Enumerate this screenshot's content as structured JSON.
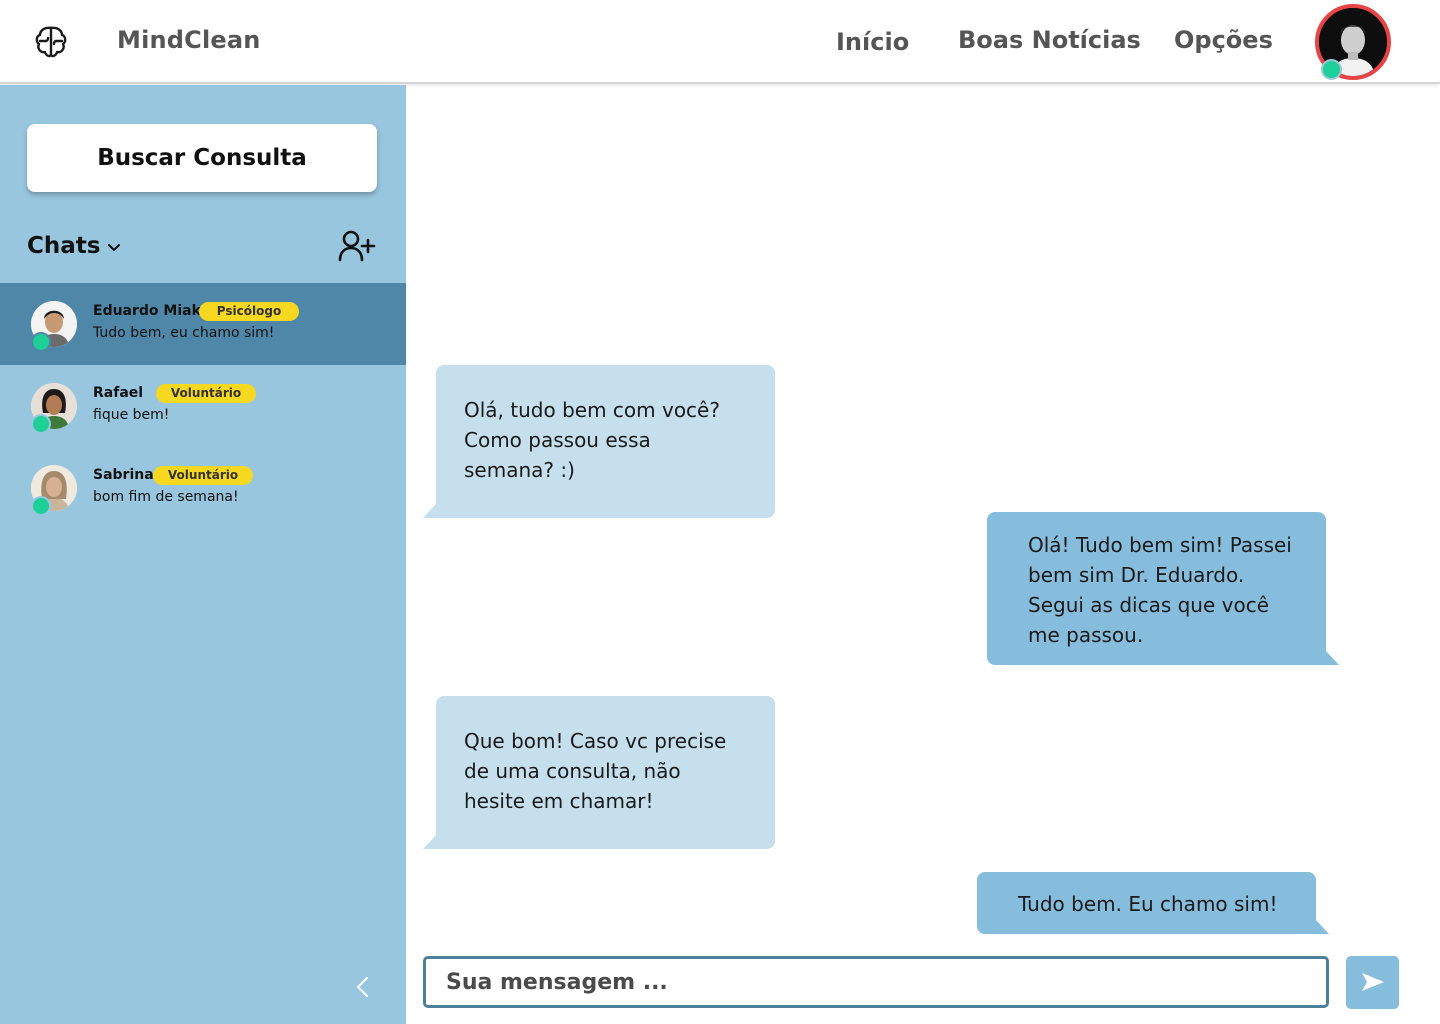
{
  "app": {
    "brand": "MindClean"
  },
  "nav": {
    "items": [
      "Início",
      "Boas Notícias",
      "Opções"
    ]
  },
  "sidebar": {
    "search_button": "Buscar Consulta",
    "chats_label": "Chats",
    "chats": [
      {
        "name": "Eduardo Miaki",
        "role": "Psicólogo",
        "preview": "Tudo bem, eu chamo sim!",
        "active": true
      },
      {
        "name": "Rafael",
        "role": "Voluntário",
        "preview": "fique bem!",
        "active": false
      },
      {
        "name": "Sabrina",
        "role": "Voluntário",
        "preview": "bom fim de semana!",
        "active": false
      }
    ]
  },
  "messages": [
    {
      "direction": "in",
      "text": "Olá, tudo bem com você?\nComo passou essa\nsemana? :)"
    },
    {
      "direction": "out",
      "text": "Olá! Tudo bem sim! Passei\nbem sim Dr. Eduardo.\nSegui as dicas que você\nme passou."
    },
    {
      "direction": "in",
      "text": "Que bom! Caso vc precise\nde uma consulta, não\nhesite em chamar!"
    },
    {
      "direction": "out",
      "text": "Tudo bem. Eu chamo sim!"
    }
  ],
  "composer": {
    "placeholder": "Sua mensagem ..."
  },
  "icons": {
    "logo": "brain-icon",
    "chats_toggle": "chevron-down-icon",
    "add_user": "add-user-icon",
    "collapse": "chevron-left-icon",
    "send": "send-icon"
  },
  "colors": {
    "sidebar": "#98c6df",
    "active_chat": "#4f87a8",
    "incoming_bubble": "#c5dfed",
    "outgoing_bubble": "#86bddc",
    "badge": "#f7d820",
    "online": "#1ecf97",
    "avatar_ring": "#e84446"
  }
}
